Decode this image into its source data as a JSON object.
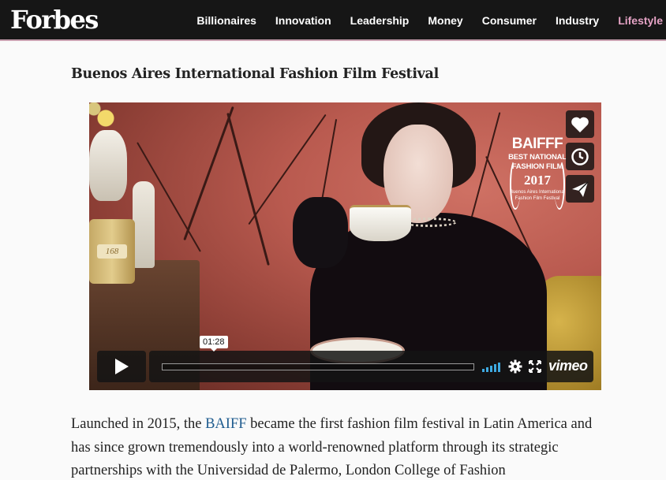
{
  "header": {
    "logo": "Forbes",
    "nav": [
      "Billionaires",
      "Innovation",
      "Leadership",
      "Money",
      "Consumer",
      "Industry",
      "Lifestyle"
    ],
    "active_nav": "Lifestyle",
    "underline_color": "#c8a0b0"
  },
  "article": {
    "title": "Buenos Aires International Fashion Film Festival",
    "paragraph": {
      "before_link": "Launched in 2015, the ",
      "link": "BAIFF",
      "after_link": " became the first fashion film festival in Latin America and has since grown tremendously into a world-renowned platform through its strategic partnerships with the Universidad de Palermo, London College of Fashion"
    }
  },
  "video": {
    "jar_label": "168",
    "badge": {
      "logo": "BAIFFF",
      "line1": "BEST NATIONAL",
      "line2": "FASHION FILM",
      "year": "2017",
      "small1": "Buenos Aires International",
      "small2": "Fashion Film Festival"
    },
    "side_buttons": [
      "heart-icon",
      "clock-icon",
      "send-icon"
    ],
    "player": {
      "time": "01:28",
      "progress": 0.0,
      "brand": "vimeo",
      "accent_color": "#3ea9e0"
    }
  }
}
